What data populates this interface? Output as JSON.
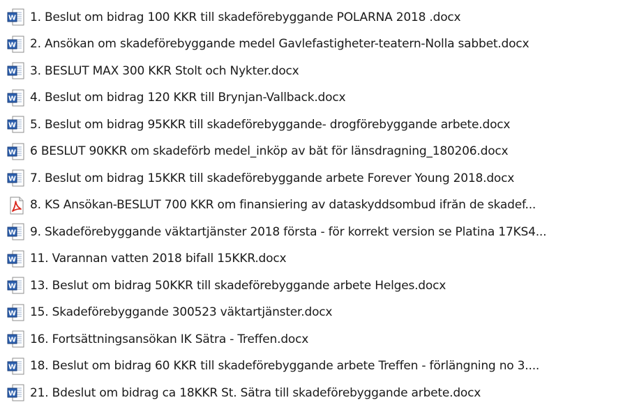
{
  "files": [
    {
      "name": "1. Beslut om bidrag 100 KKR till skadeförebyggande POLARNA 2018 .docx",
      "icon": "word-document-icon"
    },
    {
      "name": "2. Ansökan om skadeförebyggande medel Gavlefastigheter-teatern-Nolla sabbet.docx",
      "icon": "word-document-icon"
    },
    {
      "name": "3. BESLUT MAX 300 KKR Stolt och Nykter.docx",
      "icon": "word-document-icon"
    },
    {
      "name": "4. Beslut om bidrag 120 KKR till Brynjan-Vallback.docx",
      "icon": "word-document-icon"
    },
    {
      "name": "5. Beslut om bidrag 95KKR till skadeförebyggande- drogförebyggande arbete.docx",
      "icon": "word-document-icon"
    },
    {
      "name": "6  BESLUT 90KKR om skadeförb medel_inköp av båt för länsdragning_180206.docx",
      "icon": "word-document-icon"
    },
    {
      "name": "7. Beslut om bidrag 15KKR till skadeförebyggande arbete Forever Young 2018.docx",
      "icon": "word-document-icon"
    },
    {
      "name": "8. KS Ansökan-BESLUT 700 KKR om finansiering av dataskyddsombud ifrån de skadef...",
      "icon": "pdf-document-icon"
    },
    {
      "name": "9. Skadeförebyggande väktartjänster 2018 första - för korrekt version se Platina 17KS4...",
      "icon": "word-document-icon"
    },
    {
      "name": "11. Varannan vatten 2018 bifall 15KKR.docx",
      "icon": "word-document-icon"
    },
    {
      "name": "13. Beslut om bidrag 50KKR till skadeförebyggande arbete Helges.docx",
      "icon": "word-document-icon"
    },
    {
      "name": "15. Skadeförebyggande 300523 väktartjänster.docx",
      "icon": "word-document-icon"
    },
    {
      "name": "16. Fortsättningsansökan IK Sätra - Treffen.docx",
      "icon": "word-document-icon"
    },
    {
      "name": "18. Beslut om bidrag 60 KKR till skadeförebyggande arbete Treffen - förlängning no 3....",
      "icon": "word-document-icon"
    },
    {
      "name": "21. Bdeslut om bidrag ca 18KKR St. Sätra till skadeförebyggande arbete.docx",
      "icon": "word-document-icon"
    }
  ],
  "colors": {
    "word_blue": "#2b5fae",
    "word_blue_dark": "#1c3f7a",
    "pdf_red": "#d9261c",
    "page_border": "#8e8e8e",
    "text": "#1a1a1a"
  }
}
